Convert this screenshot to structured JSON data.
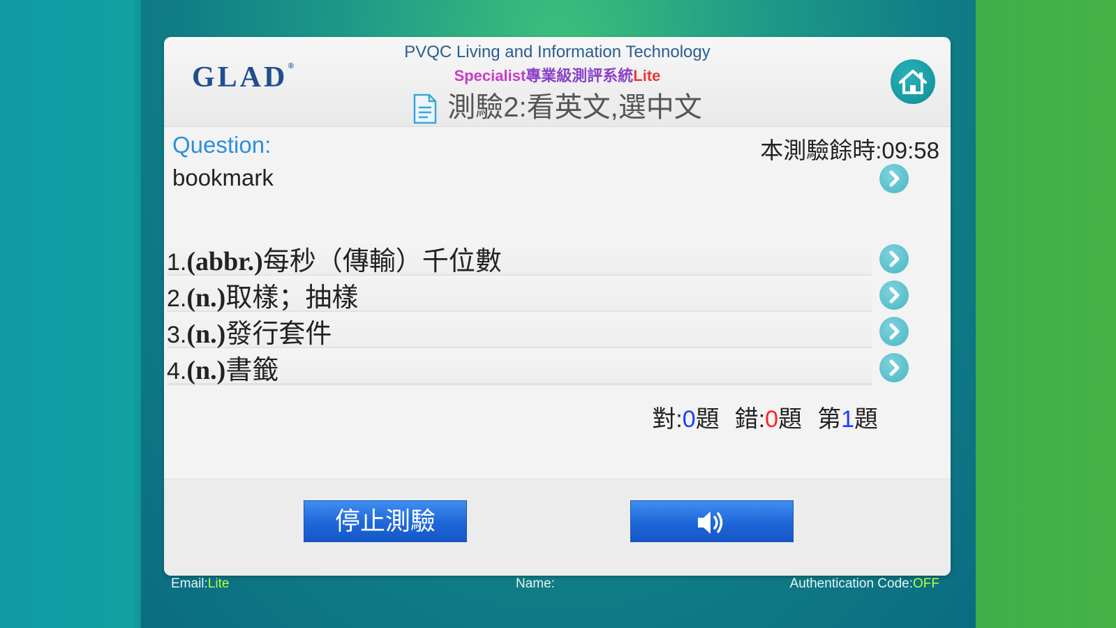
{
  "header": {
    "logo": "GLAD",
    "logo_reg": "®",
    "title_line1": "PVQC Living and Information Technology",
    "title_line2_part1": "Specialist",
    "title_line2_part2": "專業級測評系統",
    "title_line2_part3": "Lite",
    "test_title": "測驗2:看英文,選中文",
    "home_icon": "home-icon"
  },
  "question": {
    "label": "Question:",
    "word": "bookmark",
    "timer": "本測驗餘時:09:58"
  },
  "options": [
    {
      "num": "1.",
      "pos": "(abbr.)",
      "text": "每秒（傳輸）千位數"
    },
    {
      "num": "2.",
      "pos": "(n.)",
      "text": "取樣；抽樣"
    },
    {
      "num": "3.",
      "pos": "(n.)",
      "text": "發行套件"
    },
    {
      "num": "4.",
      "pos": "(n.)",
      "text": "書籤"
    }
  ],
  "stats": {
    "correct_label": "對:",
    "correct_value": "0",
    "correct_unit": "題",
    "wrong_label": "錯:",
    "wrong_value": "0",
    "wrong_unit": "題",
    "current_label": "第",
    "current_value": "1",
    "current_unit": "題"
  },
  "buttons": {
    "stop": "停止測驗",
    "sound_icon": "speaker-icon"
  },
  "status": {
    "email_label": "Email:",
    "email_value": "Lite",
    "name_label": "Name:",
    "auth_label": "Authentication Code:",
    "auth_value": "OFF"
  },
  "colors": {
    "accent_blue": "#2d8fd8",
    "button_blue": "#1f66d8",
    "arrow_teal": "#48b6c4",
    "correct_blue": "#1a3cff",
    "wrong_red": "#ff2222",
    "lime": "#b8ff3a"
  }
}
